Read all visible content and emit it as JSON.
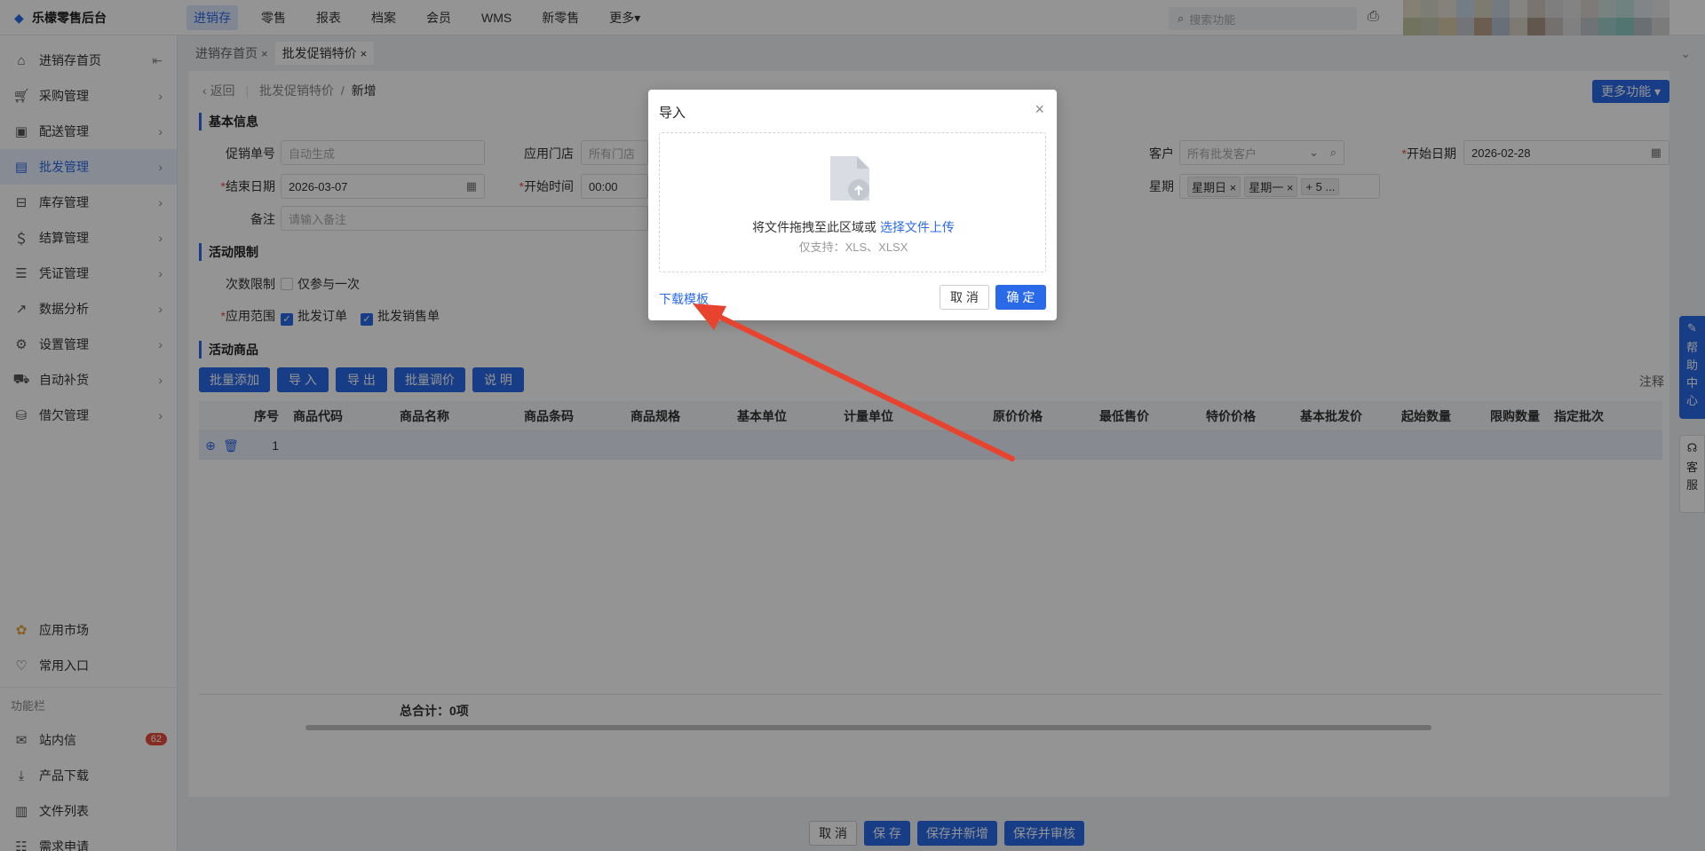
{
  "app": {
    "title": "乐檬零售后台"
  },
  "top_nav": [
    "进销存",
    "零售",
    "报表",
    "档案",
    "会员",
    "WMS",
    "新零售",
    "更多▾"
  ],
  "top_search_placeholder": "搜索功能",
  "sidebar": {
    "items": [
      {
        "label": "进销存首页",
        "icon": "home-icon"
      },
      {
        "label": "采购管理",
        "icon": "cart-icon"
      },
      {
        "label": "配送管理",
        "icon": "delivery-icon"
      },
      {
        "label": "批发管理",
        "icon": "wholesale-icon"
      },
      {
        "label": "库存管理",
        "icon": "inventory-icon"
      },
      {
        "label": "结算管理",
        "icon": "settlement-icon"
      },
      {
        "label": "凭证管理",
        "icon": "voucher-icon"
      },
      {
        "label": "数据分析",
        "icon": "chart-icon"
      },
      {
        "label": "设置管理",
        "icon": "settings-icon"
      },
      {
        "label": "自动补货",
        "icon": "replenish-icon"
      },
      {
        "label": "借欠管理",
        "icon": "debt-icon"
      }
    ],
    "bottom": [
      {
        "label": "应用市场",
        "icon": "app-market-icon"
      },
      {
        "label": "常用入口",
        "icon": "heart-icon"
      }
    ],
    "section_label": "功能栏",
    "tools": [
      {
        "label": "站内信",
        "icon": "mail-icon",
        "badge": "62"
      },
      {
        "label": "产品下载",
        "icon": "download-icon"
      },
      {
        "label": "文件列表",
        "icon": "file-list-icon"
      },
      {
        "label": "需求申请",
        "icon": "request-icon"
      }
    ]
  },
  "tabs": [
    {
      "label": "进销存首页"
    },
    {
      "label": "批发促销特价"
    }
  ],
  "breadcrumb": {
    "back": "返回",
    "parent": "批发促销特价",
    "sep": "/",
    "current": "新增"
  },
  "more_functions": "更多功能 ▾",
  "form": {
    "section_basic": "基本信息",
    "promo_no_label": "促销单号",
    "promo_no_placeholder": "自动生成",
    "store_label": "应用门店",
    "store_placeholder": "所有门店",
    "customer_label": "客户",
    "customer_placeholder": "所有批发客户",
    "start_date_label": "开始日期",
    "start_date": "2026-02-28",
    "end_date_label": "结束日期",
    "end_date": "2026-03-07",
    "start_time_label": "开始时间",
    "start_time": "00:00",
    "weekday_label": "星期",
    "weekday_tags": [
      "星期日",
      "星期一"
    ],
    "weekday_more": "+ 5 ...",
    "remark_label": "备注",
    "remark_placeholder": "请输入备注",
    "section_limit": "活动限制",
    "times_limit_label": "次数限制",
    "times_limit_option": "仅参与一次",
    "scope_label": "应用范围",
    "scope_options": [
      "批发订单",
      "批发销售单"
    ],
    "section_goods": "活动商品"
  },
  "goods_buttons": [
    "批量添加",
    "导 入",
    "导 出",
    "批量调价",
    "说 明"
  ],
  "note_label": "注释",
  "table": {
    "columns": [
      "序号",
      "商品代码",
      "商品名称",
      "商品条码",
      "商品规格",
      "基本单位",
      "计量单位",
      "原价价格",
      "最低售价",
      "特价价格",
      "基本批发价",
      "起始数量",
      "限购数量",
      "指定批次"
    ],
    "rows": [
      {
        "index": "1"
      }
    ],
    "total": "总合计：0项"
  },
  "actions": [
    "取 消",
    "保 存",
    "保存并新增",
    "保存并审核"
  ],
  "help_center": "帮助中心",
  "customer_service": "客服",
  "modal": {
    "title": "导入",
    "drop_text": "将文件拖拽至此区域或",
    "upload_link": "选择文件上传",
    "support_text": "仅支持：XLS、XLSX",
    "download_template": "下载模板",
    "cancel": "取 消",
    "ok": "确 定"
  },
  "colors": {
    "accent": "#2a6ae9",
    "annotation_arrow": "#e8432e"
  }
}
